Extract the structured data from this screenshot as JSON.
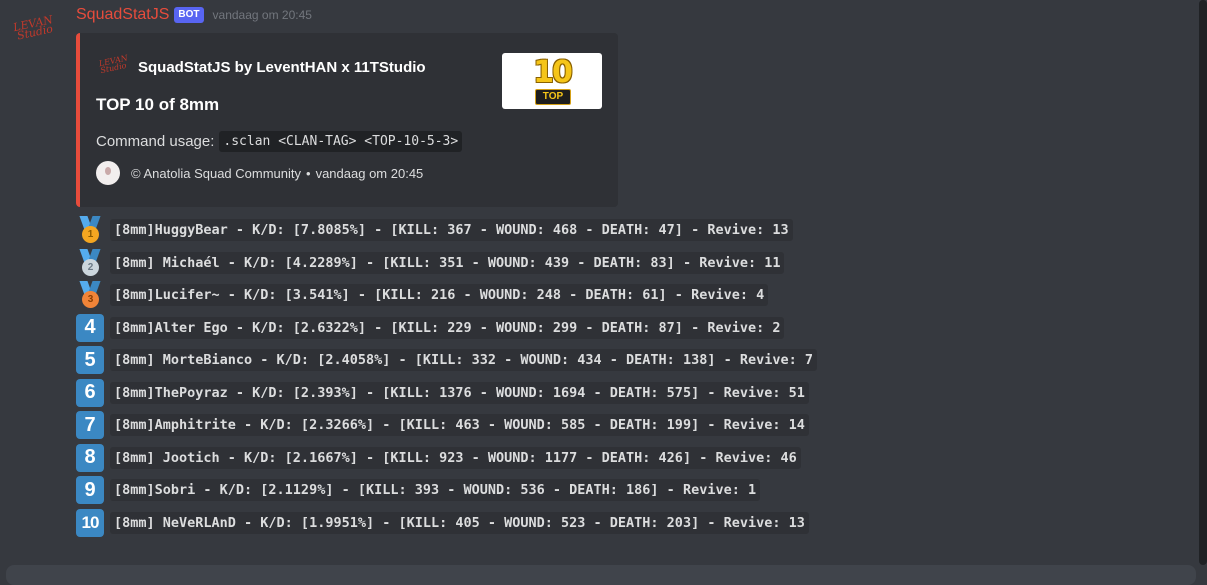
{
  "message": {
    "username": "SquadStatJS",
    "bot_badge": "BOT",
    "timestamp": "vandaag om 20:45",
    "avatar_text": "LEVAN Studio"
  },
  "embed": {
    "accent_color": "#e74c3c",
    "author_name": "SquadStatJS by LeventHAN x 11TStudio",
    "title": "TOP 10 of 8mm",
    "description_label": "Command usage:",
    "command": ".sclan <CLAN-TAG> <TOP-10-5-3>",
    "footer_text": "© Anatolia Squad Community",
    "footer_separator": "•",
    "footer_timestamp": "vandaag om 20:45",
    "thumbnail": {
      "number": "10",
      "label": "TOP"
    }
  },
  "leaderboard": [
    {
      "rank": "1",
      "icon": "first-place-medal-icon",
      "text": "[8mm]HuggyBear - K/D: [7.8085%] - [KILL: 367 - WOUND: 468 - DEATH: 47] - Revive: 13"
    },
    {
      "rank": "2",
      "icon": "second-place-medal-icon",
      "text": "[8mm] Michaél - K/D: [4.2289%] - [KILL: 351 - WOUND: 439 - DEATH: 83] - Revive: 11"
    },
    {
      "rank": "3",
      "icon": "third-place-medal-icon",
      "text": "[8mm]Lucifer~ - K/D: [3.541%] - [KILL: 216 - WOUND: 248 - DEATH: 61] - Revive: 4"
    },
    {
      "rank": "4",
      "icon": "keycap-4-icon",
      "text": "[8mm]Alter Ego - K/D: [2.6322%] - [KILL: 229 - WOUND: 299 - DEATH: 87] - Revive: 2"
    },
    {
      "rank": "5",
      "icon": "keycap-5-icon",
      "text": "[8mm] MorteBianco - K/D: [2.4058%] - [KILL: 332 - WOUND: 434 - DEATH: 138] - Revive: 7"
    },
    {
      "rank": "6",
      "icon": "keycap-6-icon",
      "text": "[8mm]ThePoyraz - K/D: [2.393%] - [KILL: 1376 - WOUND: 1694 - DEATH: 575] - Revive: 51"
    },
    {
      "rank": "7",
      "icon": "keycap-7-icon",
      "text": "[8mm]Amphitrite - K/D: [2.3266%] - [KILL: 463 - WOUND: 585 - DEATH: 199] - Revive: 14"
    },
    {
      "rank": "8",
      "icon": "keycap-8-icon",
      "text": "[8mm] Jootich - K/D: [2.1667%] - [KILL: 923 - WOUND: 1177 - DEATH: 426] - Revive: 46"
    },
    {
      "rank": "9",
      "icon": "keycap-9-icon",
      "text": "[8mm]Sobri - K/D: [2.1129%] - [KILL: 393 - WOUND: 536 - DEATH: 186] - Revive: 1"
    },
    {
      "rank": "10",
      "icon": "keycap-10-icon",
      "text": "[8mm] NeVeRLAnD - K/D: [1.9951%] - [KILL: 405 - WOUND: 523 - DEATH: 203] - Revive: 13"
    }
  ]
}
